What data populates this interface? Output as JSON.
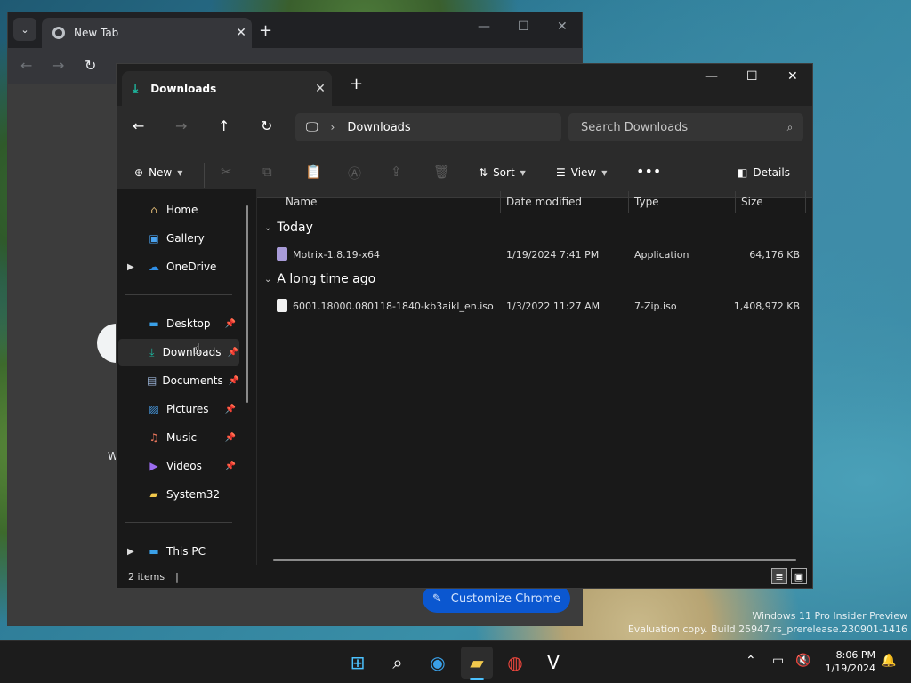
{
  "desktop": {
    "watermark_line1": "Windows 11 Pro Insider Preview",
    "watermark_line2": "Evaluation copy. Build 25947.rs_prerelease.230901-1416"
  },
  "chrome": {
    "tab_title": "New Tab",
    "customize_label": "Customize Chrome",
    "partial_text": "W"
  },
  "explorer": {
    "tab_title": "Downloads",
    "address": {
      "segments": [
        "Downloads"
      ]
    },
    "search": {
      "placeholder": "Search Downloads"
    },
    "commandbar": {
      "new_label": "New",
      "sort_label": "Sort",
      "view_label": "View",
      "details_label": "Details"
    },
    "nav_pane": {
      "items": [
        {
          "label": "Home",
          "icon": "home-icon"
        },
        {
          "label": "Gallery",
          "icon": "gallery-icon"
        },
        {
          "label": "OneDrive",
          "icon": "cloud-icon"
        },
        {
          "label": "Desktop",
          "icon": "desktop-icon",
          "pinned": true
        },
        {
          "label": "Downloads",
          "icon": "download-icon",
          "pinned": true,
          "selected": true
        },
        {
          "label": "Documents",
          "icon": "document-icon",
          "pinned": true
        },
        {
          "label": "Pictures",
          "icon": "picture-icon",
          "pinned": true
        },
        {
          "label": "Music",
          "icon": "music-icon",
          "pinned": true
        },
        {
          "label": "Videos",
          "icon": "video-icon",
          "pinned": true
        },
        {
          "label": "System32",
          "icon": "folder-icon"
        },
        {
          "label": "This PC",
          "icon": "pc-icon"
        }
      ]
    },
    "columns": [
      "Name",
      "Date modified",
      "Type",
      "Size"
    ],
    "groups": [
      {
        "label": "Today",
        "files": [
          {
            "name": "Motrix-1.8.19-x64",
            "date": "1/19/2024 7:41 PM",
            "type": "Application",
            "size": "64,176 KB"
          }
        ]
      },
      {
        "label": "A long time ago",
        "files": [
          {
            "name": "6001.18000.080118-1840-kb3aikl_en.iso",
            "date": "1/3/2022 11:27 AM",
            "type": "7-Zip.iso",
            "size": "1,408,972 KB"
          }
        ]
      }
    ],
    "status": "2 items"
  },
  "taskbar": {
    "time": "8:06 PM",
    "date": "1/19/2024",
    "accent": "#4cc2ff"
  }
}
